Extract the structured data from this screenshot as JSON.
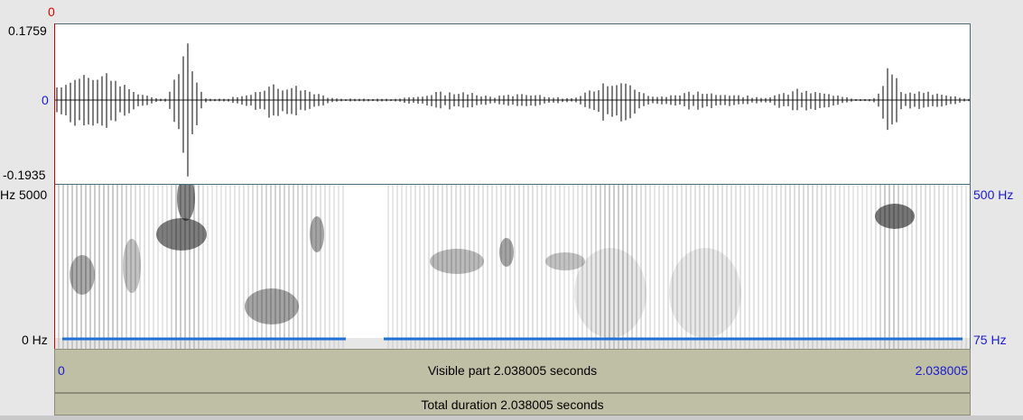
{
  "cursor": {
    "time_label": "0"
  },
  "waveform": {
    "y_max_label": "0.1759",
    "y_zero_label": "0",
    "y_min_label": "-0.1935"
  },
  "spectrogram": {
    "freq_top_label": "5000 Hz",
    "freq_bottom_label": "0 Hz",
    "pitch_top_label": "500 Hz",
    "pitch_bottom_label": "75 Hz",
    "pitch_color": "#1f6fd6"
  },
  "visible_bar": {
    "start_label": "0",
    "text": "Visible part 2.038005 seconds",
    "end_label": "2.038005"
  },
  "total_bar": {
    "text": "Total duration 2.038005 seconds"
  }
}
